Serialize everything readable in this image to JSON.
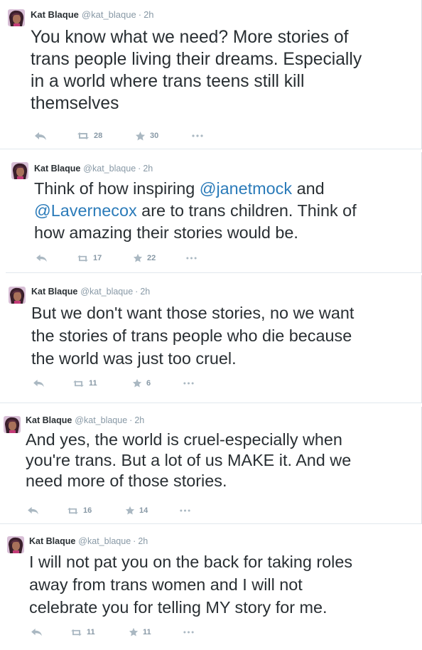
{
  "author": {
    "name": "Kat Blaque",
    "handle": "@kat_blaque",
    "separator": "·",
    "time": "2h"
  },
  "colors": {
    "text": "#292f33",
    "muted": "#8899a6",
    "mention": "#2b7bb9",
    "divider": "#e1e8ed"
  },
  "icons": {
    "reply": "reply-icon",
    "retweet": "retweet-icon",
    "favorite": "star-icon",
    "more": "more-dots-icon"
  },
  "tweets": [
    {
      "lines": [
        "You know what we need? More stories of",
        "trans people living their dreams. Especially",
        "in a world where trans teens still kill",
        "themselves"
      ],
      "retweets": "28",
      "favorites": "30"
    },
    {
      "line1_pre": "Think of how inspiring ",
      "mention1": "@janetmock",
      "line1_post": " and",
      "mention2": "@Lavernecox",
      "line2_post": " are to trans children. Think of",
      "line3": "how amazing their stories would be.",
      "retweets": "17",
      "favorites": "22"
    },
    {
      "lines": [
        "But we don't want those stories, no we want",
        "the stories of trans people who die because",
        "the world was just too cruel."
      ],
      "retweets": "11",
      "favorites": "6"
    },
    {
      "lines": [
        "And yes, the world is cruel-especially when",
        "you're trans. But a lot of us MAKE it. And we",
        "need more of those stories."
      ],
      "retweets": "16",
      "favorites": "14"
    },
    {
      "lines": [
        "I will not pat you on the back for taking roles",
        "away from trans women and I will not",
        "celebrate you for telling MY story for me."
      ],
      "retweets": "11",
      "favorites": "11"
    }
  ]
}
